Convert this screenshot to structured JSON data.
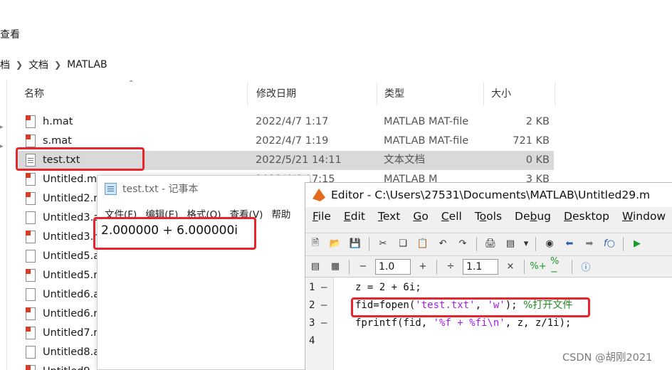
{
  "explorer": {
    "view_menu": "查看",
    "breadcrumb": [
      "档",
      "文档",
      "MATLAB"
    ],
    "columns": {
      "name": "名称",
      "date": "修改日期",
      "type": "类型",
      "size": "大小"
    },
    "files": [
      {
        "name": "h.mat",
        "date": "2022/4/7 1:17",
        "type": "MATLAB MAT-file",
        "size": "2 KB",
        "icon": "mat-file-icon"
      },
      {
        "name": "s.mat",
        "date": "2022/4/7 1:19",
        "type": "MATLAB MAT-file",
        "size": "721 KB",
        "icon": "mat-file-icon"
      },
      {
        "name": "test.txt",
        "date": "2022/5/21 14:11",
        "type": "文本文档",
        "size": "0 KB",
        "icon": "text-file-icon"
      },
      {
        "name": "Untitled.m",
        "date": "2022/4/6 17:15",
        "type": "MATLAB M",
        "size": "3 KB",
        "icon": "mat-file-icon"
      },
      {
        "name": "Untitled2.m",
        "icon": "mat-file-icon"
      },
      {
        "name": "Untitled3.a",
        "icon": "text-file-icon"
      },
      {
        "name": "Untitled3.m",
        "icon": "mat-file-icon"
      },
      {
        "name": "Untitled5.a",
        "icon": "text-file-icon"
      },
      {
        "name": "Untitled5.m",
        "icon": "mat-file-icon"
      },
      {
        "name": "Untitled6.a",
        "icon": "text-file-icon"
      },
      {
        "name": "Untitled6.m",
        "icon": "mat-file-icon"
      },
      {
        "name": "Untitled7.m",
        "icon": "mat-file-icon"
      },
      {
        "name": "Untitled8.a",
        "icon": "text-file-icon"
      },
      {
        "name": "Untitled9",
        "icon": "mat-file-icon"
      }
    ]
  },
  "notepad": {
    "title": "test.txt - 记事本",
    "menu": [
      "文件(F)",
      "编辑(E)",
      "格式(O)",
      "查看(V)",
      "帮助"
    ],
    "content": "2.000000 + 6.000000i"
  },
  "editor": {
    "title": "Editor - C:\\Users\\27531\\Documents\\MATLAB\\Untitled29.m",
    "menu": [
      {
        "underline": "F",
        "rest": "ile"
      },
      {
        "underline": "E",
        "rest": "dit"
      },
      {
        "underline": "T",
        "rest": "ext"
      },
      {
        "underline": "G",
        "rest": "o"
      },
      {
        "underline": "C",
        "rest": "ell"
      },
      {
        "pre": "T",
        "underline": "o",
        "rest": "ols"
      },
      {
        "pre": "De",
        "underline": "b",
        "rest": "ug"
      },
      {
        "underline": "D",
        "rest": "esktop"
      },
      {
        "underline": "W",
        "rest": "indow"
      }
    ],
    "cell_value_1": "1.0",
    "cell_value_2": "1.1",
    "lines": [
      {
        "num": "1",
        "dash": "–",
        "code": "z = 2 + 6i;"
      },
      {
        "num": "2",
        "dash": "–",
        "pre": "fid=fopen(",
        "str1": "'test.txt'",
        "mid": ", ",
        "str2": "'w'",
        "post": "); ",
        "comment": "%打开文件"
      },
      {
        "num": "3",
        "dash": "–",
        "pre": "fprintf(fid, ",
        "str1": "'%f + %fi\\n'",
        "post": ", z, z/1i);"
      },
      {
        "num": "4",
        "dash": "",
        "code": ""
      }
    ]
  },
  "watermark": "CSDN @胡刚2021",
  "colors": {
    "highlight_red": "#e8252c",
    "selected_row": "#d9d9d9",
    "string_purple": "#a020f0",
    "comment_green": "#228b22"
  }
}
